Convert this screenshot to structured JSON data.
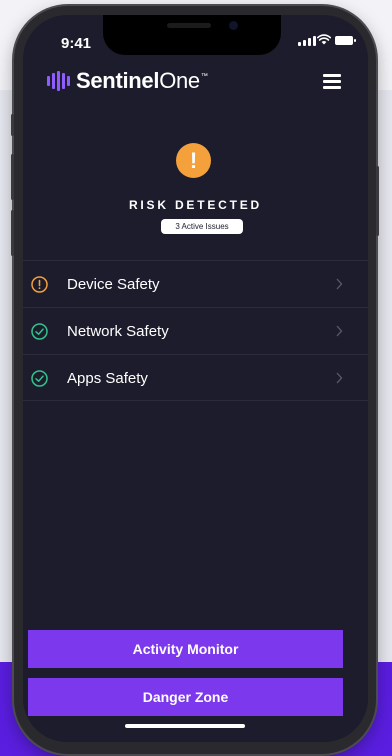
{
  "status_bar": {
    "time": "9:41"
  },
  "header": {
    "logo_bold": "Sentinel",
    "logo_light": "One",
    "logo_tm": "™"
  },
  "risk": {
    "icon_glyph": "!",
    "title": "RISK DETECTED",
    "issues_badge": "3 Active Issues",
    "accent": "#f4a03b"
  },
  "safety_items": [
    {
      "label": "Device Safety",
      "status": "warning",
      "icon": "warning-circle-icon",
      "color": "#f4a03b"
    },
    {
      "label": "Network Safety",
      "status": "ok",
      "icon": "check-circle-icon",
      "color": "#34c28b"
    },
    {
      "label": "Apps Safety",
      "status": "ok",
      "icon": "check-circle-icon",
      "color": "#34c28b"
    }
  ],
  "buttons": {
    "activity_monitor": "Activity Monitor",
    "danger_zone": "Danger Zone"
  },
  "colors": {
    "screen_bg": "#1d1c2c",
    "button_bg": "#7b38ec",
    "brand_purple": "#8e5cff",
    "page_bg_band": "#5a1ee0"
  }
}
